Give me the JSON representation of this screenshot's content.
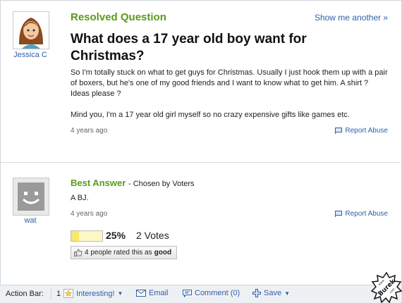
{
  "question": {
    "status": "Resolved Question",
    "show_more": "Show me another »",
    "asker": "Jessica C",
    "title": "What does a 17 year old boy want for Christmas?",
    "body_1": "So I'm totally stuck on what to get guys for Christmas. Usually I just hook them up with a pair of boxers, but he's one of my good friends and I want to know what to get him. A shirt ? Ideas please ?",
    "body_2": "Mind you, I'm a 17 year old girl myself so no crazy expensive gifts like games etc.",
    "time": "4 years ago",
    "report": "Report Abuse"
  },
  "answer": {
    "heading": "Best Answer",
    "chosen": "- Chosen by Voters",
    "text": "A BJ.",
    "answerer": "wat",
    "time": "4 years ago",
    "report": "Report Abuse",
    "vote_fraction": 0.25,
    "vote_percent": "25%",
    "vote_count": "2 Votes",
    "rated_prefix": "4 people rated this as",
    "rated_word": "good"
  },
  "action_bar": {
    "label": "Action Bar:",
    "interesting_count": "1",
    "interesting": "Interesting!",
    "email": "Email",
    "comment": "Comment (0)",
    "save": "Save"
  },
  "watermark": {
    "text": "Burek",
    "small": "www.",
    "domain": ".com"
  },
  "colors": {
    "green": "#5a9a1a",
    "link": "#2f5fa8",
    "vote_fill": "#f7e96a"
  },
  "icons": [
    "user-photo-icon",
    "default-avatar-icon",
    "flag-icon",
    "thumbs-up-icon",
    "star-icon",
    "envelope-icon",
    "comment-icon",
    "plus-icon",
    "chevron-down-icon"
  ]
}
